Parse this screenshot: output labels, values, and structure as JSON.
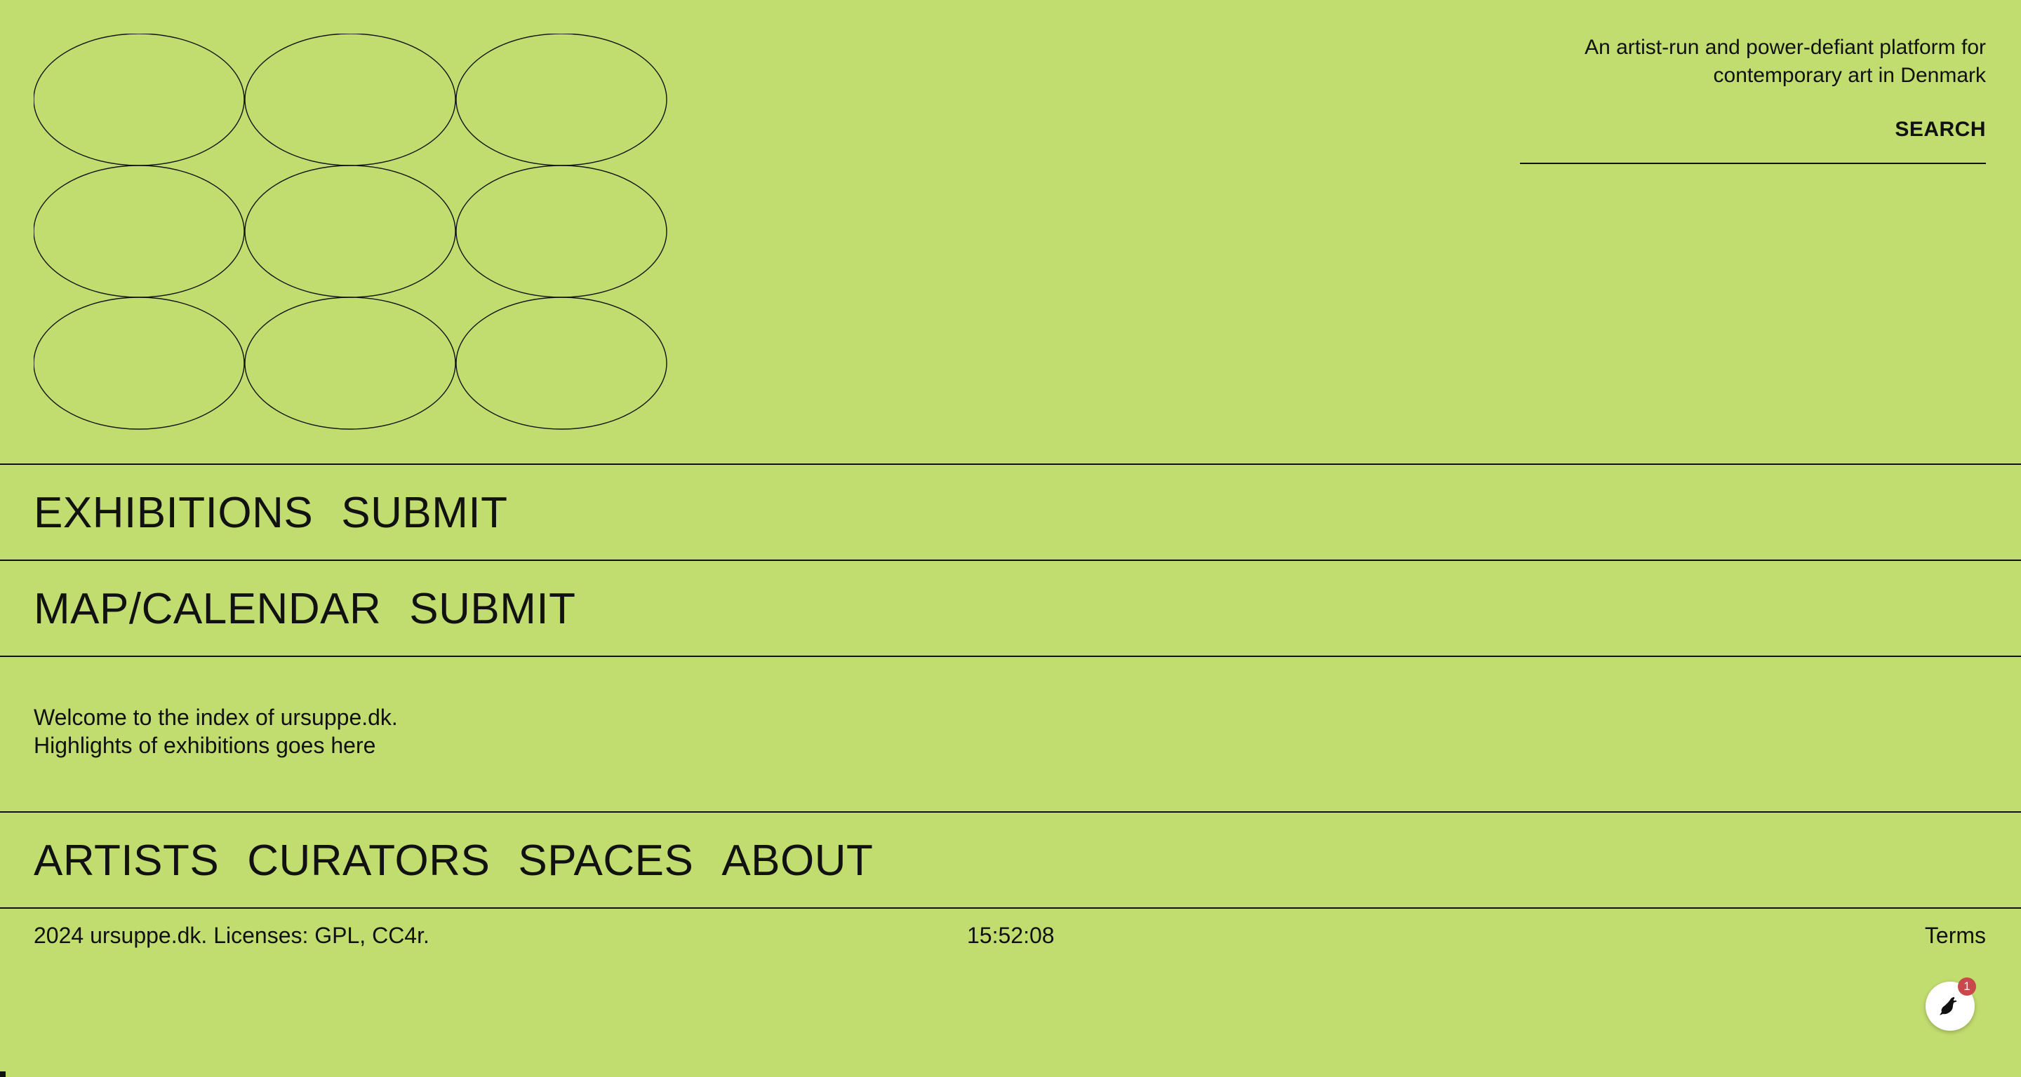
{
  "header": {
    "tagline": "An artist-run and power-defiant platform for contemporary art in Denmark",
    "search_label": "SEARCH",
    "search_value": ""
  },
  "nav_exhibitions": {
    "primary": "EXHIBITIONS",
    "submit": "SUBMIT"
  },
  "nav_map": {
    "primary": "MAP/CALENDAR",
    "submit": "SUBMIT"
  },
  "welcome": {
    "line1": "Welcome to the index of ursuppe.dk.",
    "line2": "Highlights of exhibitions goes here"
  },
  "nav_bottom": {
    "items": [
      "ARTISTS",
      "CURATORS",
      "SPACES",
      "ABOUT"
    ]
  },
  "footer": {
    "copyright": "2024 ursuppe.dk. Licenses: GPL, CC4r.",
    "time": "15:52:08",
    "terms": "Terms"
  },
  "chat_widget": {
    "icon": "bird-icon",
    "badge": "1"
  },
  "colors": {
    "background": "#c1dc6f",
    "ink": "#111111",
    "badge": "#c9484b"
  }
}
